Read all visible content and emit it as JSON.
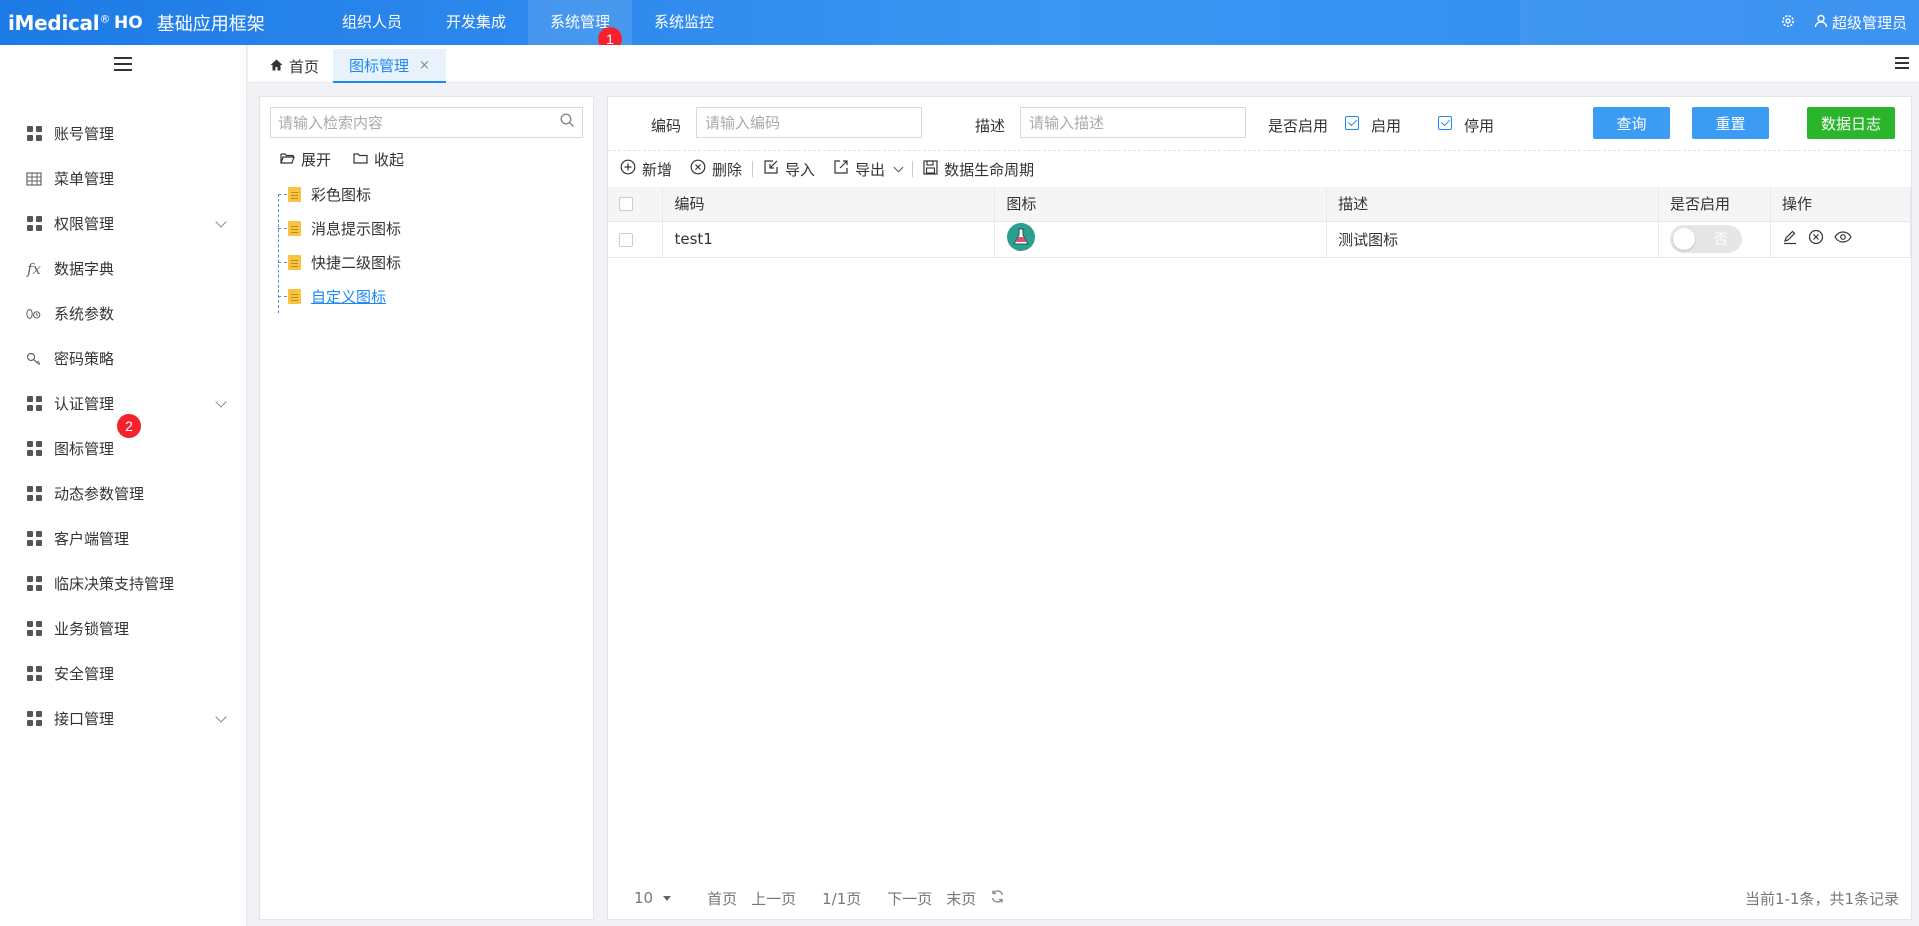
{
  "header": {
    "brand": "iMedical",
    "brand_reg": "®",
    "brand_sub": "HO",
    "app_title": "基础应用框架",
    "nav": [
      "组织人员",
      "开发集成",
      "系统管理",
      "系统监控"
    ],
    "active_nav_index": 2,
    "settings_icon": "gear-icon",
    "user": "超级管理员",
    "badge_nav": "1"
  },
  "sidebar": {
    "items": [
      {
        "label": "账号管理",
        "icon": "grid-icon"
      },
      {
        "label": "菜单管理",
        "icon": "table-icon"
      },
      {
        "label": "权限管理",
        "icon": "grid-icon",
        "expandable": true
      },
      {
        "label": "数据字典",
        "icon": "fx-icon"
      },
      {
        "label": "系统参数",
        "icon": "params-icon"
      },
      {
        "label": "密码策略",
        "icon": "key-icon"
      },
      {
        "label": "认证管理",
        "icon": "grid-icon",
        "expandable": true
      },
      {
        "label": "图标管理",
        "icon": "grid-icon"
      },
      {
        "label": "动态参数管理",
        "icon": "grid-icon"
      },
      {
        "label": "客户端管理",
        "icon": "grid-icon"
      },
      {
        "label": "临床决策支持管理",
        "icon": "grid-icon"
      },
      {
        "label": "业务锁管理",
        "icon": "grid-icon"
      },
      {
        "label": "安全管理",
        "icon": "grid-icon"
      },
      {
        "label": "接口管理",
        "icon": "grid-icon",
        "expandable": true
      }
    ],
    "badge_icon_mgmt": "2"
  },
  "tabs": {
    "home": "首页",
    "current": "图标管理",
    "close": "×"
  },
  "tree": {
    "search_placeholder": "请输入检索内容",
    "expand": "展开",
    "collapse": "收起",
    "nodes": [
      "彩色图标",
      "消息提示图标",
      "快捷二级图标",
      "自定义图标"
    ]
  },
  "filters": {
    "code_label": "编码",
    "code_placeholder": "请输入编码",
    "desc_label": "描述",
    "desc_placeholder": "请输入描述",
    "enabled_label": "是否启用",
    "opt_enabled": "启用",
    "opt_disabled": "停用",
    "query": "查询",
    "reset": "重置",
    "data_log": "数据日志"
  },
  "toolbar": {
    "add": "新增",
    "delete": "删除",
    "import": "导入",
    "export": "导出",
    "lifecycle": "数据生命周期"
  },
  "table": {
    "columns": [
      "编码",
      "图标",
      "描述",
      "是否启用",
      "操作"
    ],
    "rows": [
      {
        "code": "test1",
        "icon": "flask-icon",
        "desc": "测试图标",
        "enabled": "否"
      }
    ]
  },
  "pager": {
    "page_size": "10",
    "first": "首页",
    "prev": "上一页",
    "current": "1/1页",
    "next": "下一页",
    "last": "末页",
    "info": "当前1-1条，共1条记录"
  },
  "colors": {
    "primary": "#1e88f0",
    "green": "#2bb52a",
    "badge": "#f5222d"
  }
}
